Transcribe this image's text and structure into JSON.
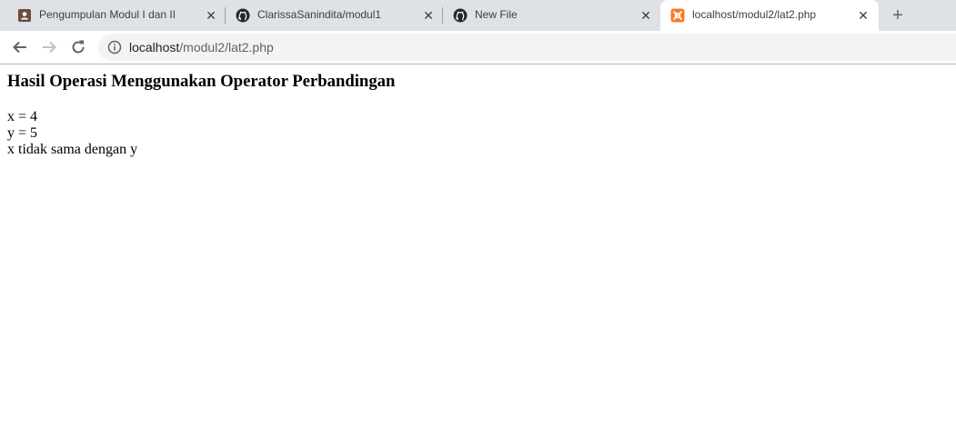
{
  "browser": {
    "tabs": [
      {
        "title": "Pengumpulan Modul I dan II",
        "icon": "classroom-icon",
        "active": false
      },
      {
        "title": "ClarissaSanindita/modul1",
        "icon": "github-icon",
        "active": false
      },
      {
        "title": "New File",
        "icon": "github-icon",
        "active": false
      },
      {
        "title": "localhost/modul2/lat2.php",
        "icon": "xampp-icon",
        "active": true
      }
    ],
    "new_tab_label": "+",
    "address": {
      "host": "localhost",
      "path": "/modul2/lat2.php"
    }
  },
  "page": {
    "heading": "Hasil Operasi Menggunakan Operator Perbandingan",
    "lines": [
      "x = 4",
      "y = 5",
      "x tidak sama dengan y"
    ]
  }
}
